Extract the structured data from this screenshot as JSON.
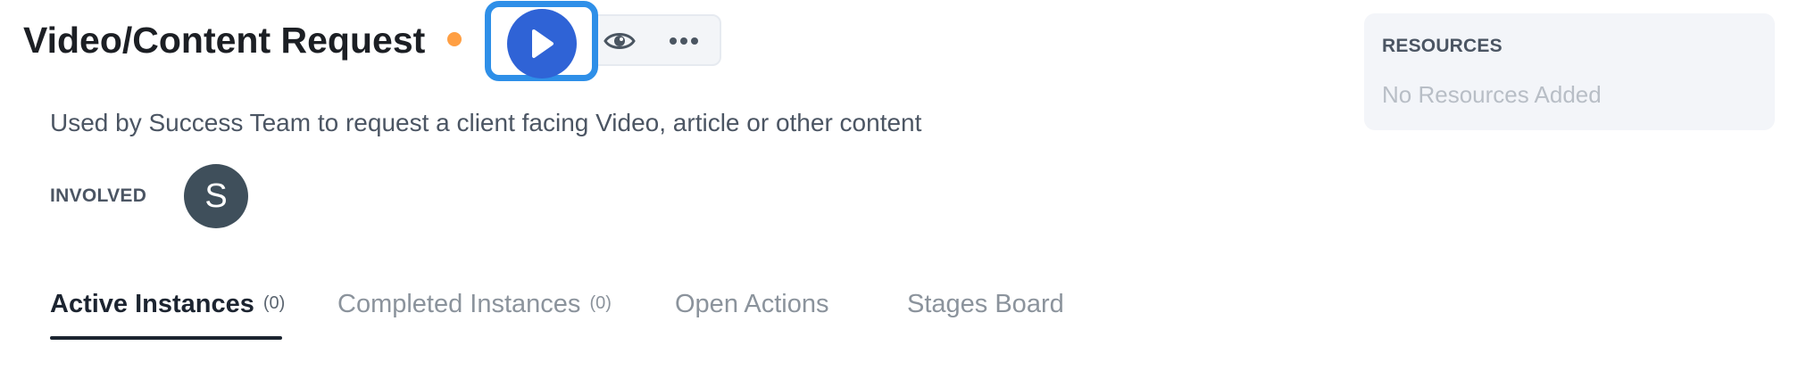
{
  "header": {
    "title": "Video/Content Request",
    "status_color": "#ff9f43",
    "actions": {
      "play_icon": "play-icon",
      "view_icon": "eye-icon",
      "more_icon": "more-horizontal-icon"
    }
  },
  "description": "Used by Success Team to request a client facing Video, article or other content",
  "involved": {
    "label": "INVOLVED",
    "avatar_initial": "S"
  },
  "tabs": [
    {
      "label": "Active Instances",
      "count": "(0)",
      "active": true
    },
    {
      "label": "Completed Instances",
      "count": "(0)",
      "active": false
    },
    {
      "label": "Open Actions",
      "count": null,
      "active": false
    },
    {
      "label": "Stages Board",
      "count": null,
      "active": false
    }
  ],
  "resources": {
    "title": "RESOURCES",
    "empty_text": "No Resources Added"
  },
  "colors": {
    "accent": "#2f63d6",
    "focus_ring": "#2e8fe8",
    "avatar_bg": "#3f4f5b"
  }
}
